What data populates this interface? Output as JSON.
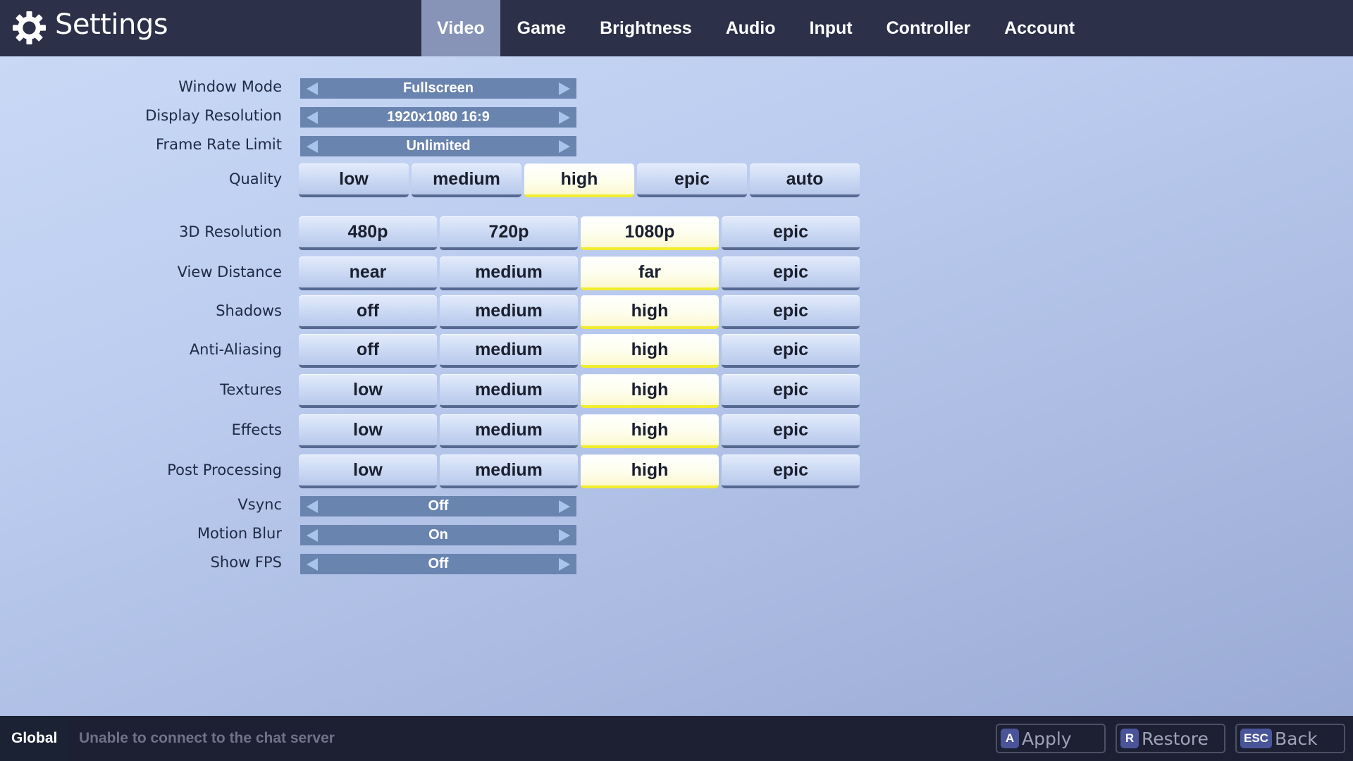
{
  "header": {
    "icon": "gear-icon",
    "title": "Settings",
    "tabs": [
      {
        "label": "Video",
        "active": true
      },
      {
        "label": "Game",
        "active": false
      },
      {
        "label": "Brightness",
        "active": false
      },
      {
        "label": "Audio",
        "active": false
      },
      {
        "label": "Input",
        "active": false
      },
      {
        "label": "Controller",
        "active": false
      },
      {
        "label": "Account",
        "active": false
      }
    ]
  },
  "settings": {
    "window_mode": {
      "label": "Window Mode",
      "value": "Fullscreen"
    },
    "display_resolution": {
      "label": "Display Resolution",
      "value": "1920x1080 16:9"
    },
    "frame_rate_limit": {
      "label": "Frame Rate Limit",
      "value": "Unlimited"
    },
    "quality": {
      "label": "Quality",
      "options": [
        "low",
        "medium",
        "high",
        "epic",
        "auto"
      ],
      "selected": "high"
    },
    "resolution_3d": {
      "label": "3D Resolution",
      "options": [
        "480p",
        "720p",
        "1080p",
        "epic"
      ],
      "selected": "1080p"
    },
    "view_distance": {
      "label": "View Distance",
      "options": [
        "near",
        "medium",
        "far",
        "epic"
      ],
      "selected": "far"
    },
    "shadows": {
      "label": "Shadows",
      "options": [
        "off",
        "medium",
        "high",
        "epic"
      ],
      "selected": "high"
    },
    "anti_aliasing": {
      "label": "Anti-Aliasing",
      "options": [
        "off",
        "medium",
        "high",
        "epic"
      ],
      "selected": "high"
    },
    "textures": {
      "label": "Textures",
      "options": [
        "low",
        "medium",
        "high",
        "epic"
      ],
      "selected": "high"
    },
    "effects": {
      "label": "Effects",
      "options": [
        "low",
        "medium",
        "high",
        "epic"
      ],
      "selected": "high"
    },
    "post_processing": {
      "label": "Post Processing",
      "options": [
        "low",
        "medium",
        "high",
        "epic"
      ],
      "selected": "high"
    },
    "vsync": {
      "label": "Vsync",
      "value": "Off"
    },
    "motion_blur": {
      "label": "Motion Blur",
      "value": "On"
    },
    "show_fps": {
      "label": "Show FPS",
      "value": "Off"
    }
  },
  "footer": {
    "channel": "Global",
    "status": "Unable to connect to the chat server",
    "buttons": [
      {
        "key": "A",
        "label": "Apply"
      },
      {
        "key": "R",
        "label": "Restore"
      },
      {
        "key": "ESC",
        "label": "Back"
      }
    ]
  },
  "colors": {
    "header_bg": "#2c3048",
    "active_tab": "#8794b8",
    "selector_bg": "#6a84b0",
    "selected_accent": "#f1ec2d",
    "footer_bg": "#1d2033",
    "key_badge": "#4a5499"
  }
}
